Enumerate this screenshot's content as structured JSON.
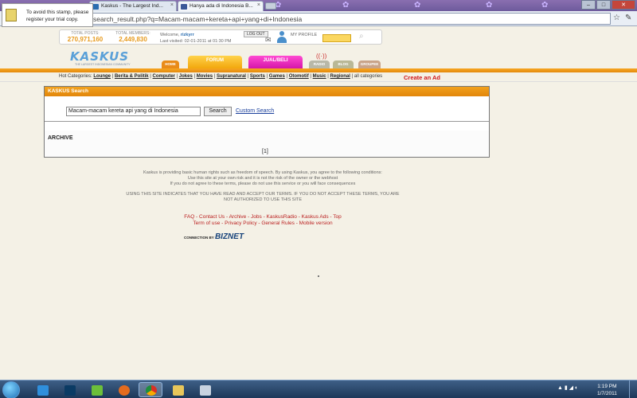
{
  "browser": {
    "tabs": [
      {
        "title": "Kaskus - The Largest Ind...",
        "close": "×"
      },
      {
        "title": "Hanya ada di Indonesia B...",
        "close": "×"
      }
    ],
    "url": "search_result.php?q=Macam-macam+kereta+api+yang+di+Indonesia",
    "window_buttons": [
      "–",
      "□",
      "✕"
    ]
  },
  "stamp": {
    "text": "To avoid this stamp, please register your trial copy."
  },
  "header": {
    "total_posts_label": "TOTAL POSTS:",
    "total_posts": "270,971,160",
    "total_members_label": "TOTAL MEMBERS:",
    "total_members": "2,449,830",
    "welcome_prefix": "Welcome,",
    "username": "rizkyrr",
    "last_visited": "Last visited: 02-01-2011 at 01:30 PM",
    "logout_label": "LOG OUT",
    "my_profile_label": "MY PROFILE",
    "logo_text": "KASKUS",
    "logo_tagline": "THE LARGEST INDONESIAN COMMUNITY"
  },
  "nav": {
    "home": "HOME",
    "forum": "FORUM",
    "jualbeli": "JUAL/BELI",
    "radio": "RADIO",
    "blog": "BLOG",
    "groupee": "GROUPEE"
  },
  "categories": {
    "prefix": "Hot Categories:",
    "items": [
      "Lounge",
      "Berita & Politik",
      "Computer",
      "Jokes",
      "Movies",
      "Supranatural",
      "Sports",
      "Games",
      "Otomotif",
      "Music",
      "Regional"
    ],
    "all": "all categories",
    "create_ad": "Create an Ad"
  },
  "search": {
    "panel_title": "KASKUS Search",
    "query": "Macam-macam kereta api yang di Indonesia",
    "button_label": "Search",
    "custom_link": "Custom Search",
    "archive_label": "ARCHIVE",
    "pager": "[1]"
  },
  "footer": {
    "legal_1": "Kaskus is providing basic human rights such as freedom of speech. By using Kaskus, you agree to the following conditions:",
    "legal_2": "Use this site at your own risk and it is not the risk of the owner or the webhost",
    "legal_3": "If you do not agree to these terms, please do not use this service or you will face consequences",
    "legal_4": "USING THIS SITE INDICATES THAT YOU HAVE READ AND ACCEPT OUR TERMS. IF YOU DO NOT ACCEPT THESE TERMS, YOU ARE",
    "legal_5": "NOT AUTHORIZED TO USE THIS SITE",
    "links_1": "FAQ - Contact Us - Archive - Jobs - KaskusRadio - Kaskus Ads - Top",
    "links_2": "Term of use - Privacy Policy - General Rules - Mobile version",
    "connection_by": "CONNECTION BY",
    "biznet": "BIZNET"
  },
  "taskbar": {
    "time": "1:19 PM",
    "date": "1/7/2011"
  }
}
